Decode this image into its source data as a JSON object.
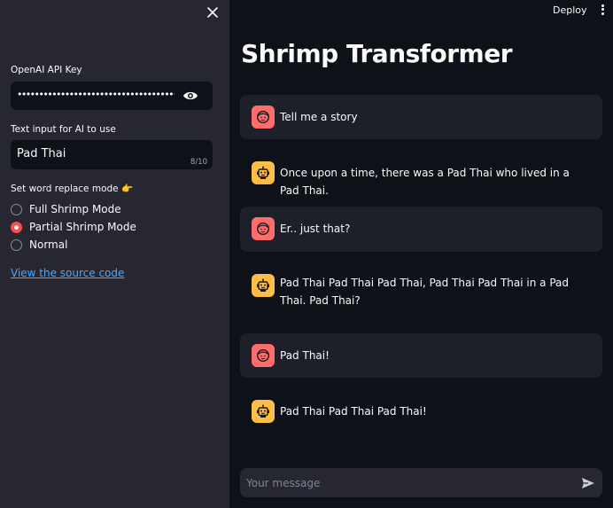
{
  "sidebar": {
    "api_key_label": "OpenAI API Key",
    "api_key_value": "••••••••••••••••••••••••••••••••••••••••••••••••••••",
    "text_input_label": "Text input for AI to use",
    "text_input_value": "Pad Thai",
    "text_input_count": "8/10",
    "mode_label": "Set word replace mode 👉",
    "modes": [
      {
        "label": "Full Shrimp Mode",
        "checked": false
      },
      {
        "label": "Partial Shrimp Mode",
        "checked": true
      },
      {
        "label": "Normal",
        "checked": false
      }
    ],
    "source_link": "View the source code"
  },
  "header": {
    "deploy_label": "Deploy"
  },
  "main": {
    "title": "Shrimp Transformer",
    "messages": [
      {
        "role": "user",
        "text": "Tell me a story"
      },
      {
        "role": "assistant",
        "text": "Once upon a time, there was a Pad Thai who lived in a Pad Thai."
      },
      {
        "role": "user",
        "text": "Er.. just that?"
      },
      {
        "role": "assistant",
        "text": "Pad Thai Pad Thai Pad Thai, Pad Thai Pad Thai in a Pad Thai. Pad Thai?"
      },
      {
        "role": "user",
        "text": "Pad Thai!"
      },
      {
        "role": "assistant",
        "text": "Pad Thai Pad Thai Pad Thai!"
      }
    ],
    "chat_placeholder": "Your message"
  },
  "colors": {
    "background": "#0e1117",
    "sidebar": "#262730",
    "accent": "#ff4b4b",
    "user_avatar": "#ff6c6c",
    "assistant_avatar": "#ffbd45",
    "link": "#4ea8ff"
  },
  "icons": {
    "close": "close-icon",
    "eye": "eye-icon",
    "more": "kebab-menu-icon",
    "user_avatar": "face-icon",
    "assistant_avatar": "robot-icon",
    "send": "send-icon"
  }
}
